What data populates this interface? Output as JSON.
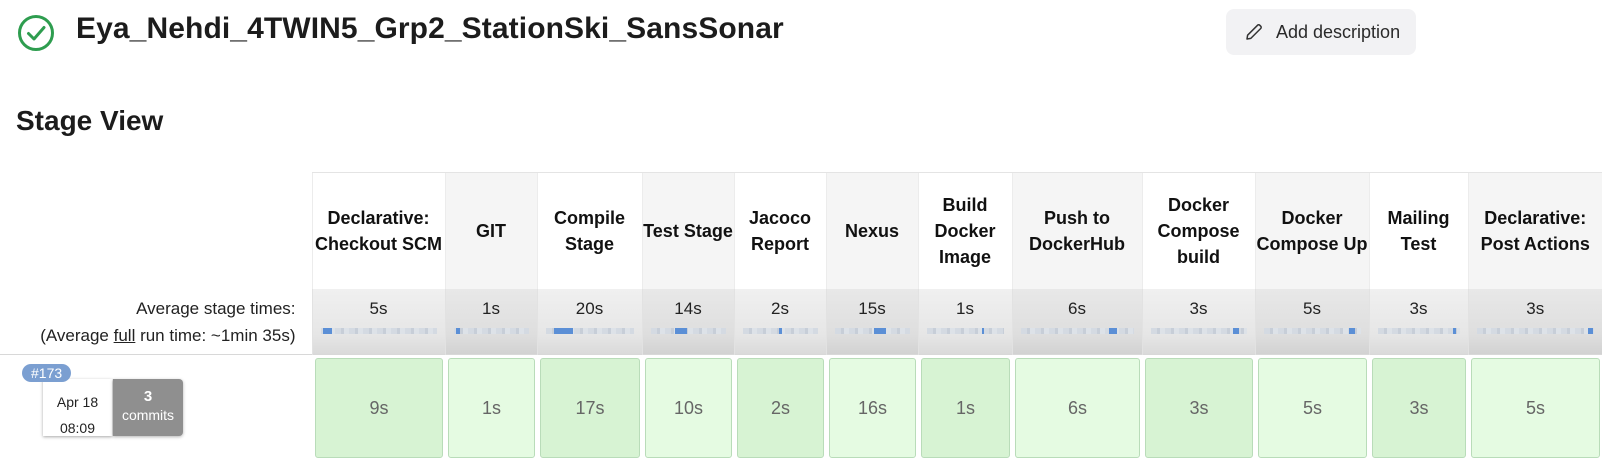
{
  "header": {
    "status_icon": "check-circle-icon",
    "status_color": "#2e9d4f",
    "job_title": "Eya_Nehdi_4TWIN5_Grp2_StationSki_SansSonar",
    "add_description_label": "Add description",
    "add_description_icon": "pencil-icon"
  },
  "stage_view": {
    "title": "Stage View",
    "average_stage_times_label": "Average stage times:",
    "average_full_prefix": "(Average ",
    "average_full_word": "full",
    "average_full_suffix": " run time: ~1min 35s)",
    "stages": [
      {
        "name": "Declarative: Checkout SCM",
        "avg": "5s",
        "avg_fraction": 0.08
      },
      {
        "name": "GIT",
        "avg": "1s",
        "avg_fraction": 0.05
      },
      {
        "name": "Compile Stage",
        "avg": "20s",
        "avg_fraction": 0.21
      },
      {
        "name": "Test Stage",
        "avg": "14s",
        "avg_fraction": 0.15
      },
      {
        "name": "Jacoco Report",
        "avg": "2s",
        "avg_fraction": 0.04
      },
      {
        "name": "Nexus",
        "avg": "15s",
        "avg_fraction": 0.16
      },
      {
        "name": "Build Docker Image",
        "avg": "1s",
        "avg_fraction": 0.03
      },
      {
        "name": "Push to DockerHub",
        "avg": "6s",
        "avg_fraction": 0.07
      },
      {
        "name": "Docker Compose build",
        "avg": "3s",
        "avg_fraction": 0.06
      },
      {
        "name": "Docker Compose Up",
        "avg": "5s",
        "avg_fraction": 0.06
      },
      {
        "name": "Mailing Test",
        "avg": "3s",
        "avg_fraction": 0.04
      },
      {
        "name": "Declarative: Post Actions",
        "avg": "3s",
        "avg_fraction": 0.04
      }
    ],
    "builds": [
      {
        "number": "#173",
        "date": "Apr 18",
        "time": "08:09",
        "commits_count": "3",
        "commits_label": "commits",
        "stage_times": [
          "9s",
          "1s",
          "17s",
          "10s",
          "2s",
          "16s",
          "1s",
          "6s",
          "3s",
          "5s",
          "3s",
          "5s"
        ]
      }
    ]
  },
  "colors": {
    "success_green_light": "#e5fbe2",
    "success_green_dark": "#d7f3d3",
    "badge_blue": "#7b9fd1",
    "bar_blue": "#5b8fd6"
  }
}
